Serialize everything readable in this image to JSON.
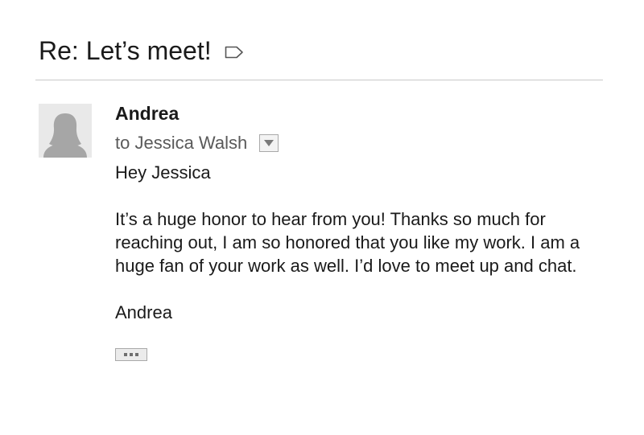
{
  "email": {
    "subject": "Re: Let’s meet!",
    "sender": "Andrea",
    "recipient": "to Jessica Walsh",
    "body": {
      "greeting": "Hey Jessica",
      "paragraph": "It’s a huge honor to hear from you! Thanks so much for reaching out, I am so honored that you like my work. I am a huge fan of your work as well. I’d love to meet up and chat.",
      "signature": "Andrea"
    }
  },
  "icons": {
    "label": "label-icon",
    "avatar": "person-silhouette-icon",
    "details": "triangle-down-icon",
    "expand": "ellipsis-icon"
  },
  "colors": {
    "text": "#1a1a1a",
    "muted": "#5a5a5a",
    "divider": "#c8c8c8",
    "avatar_bg": "#e9e9e9",
    "avatar_figure": "#a6a6a6"
  }
}
